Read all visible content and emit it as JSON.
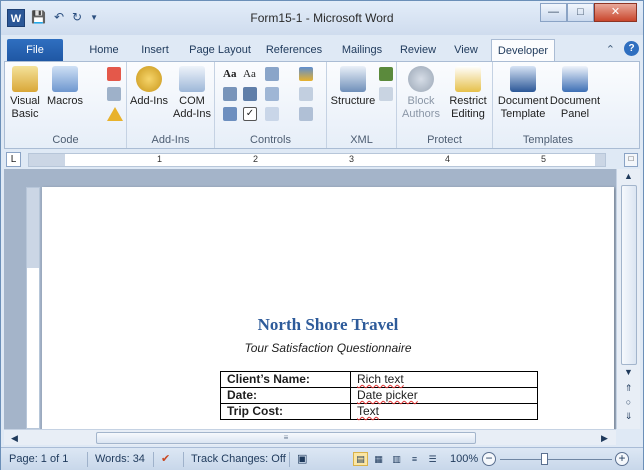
{
  "window": {
    "title": "Form15-1 - Microsoft Word",
    "app_icon": "W"
  },
  "qat": {
    "save_icon": "save-icon",
    "undo_icon": "undo-icon",
    "redo_icon": "redo-icon"
  },
  "tabs": [
    {
      "label": "File"
    },
    {
      "label": "Home"
    },
    {
      "label": "Insert"
    },
    {
      "label": "Page Layout"
    },
    {
      "label": "References"
    },
    {
      "label": "Mailings"
    },
    {
      "label": "Review"
    },
    {
      "label": "View"
    },
    {
      "label": "Developer"
    }
  ],
  "ribbon": {
    "code": {
      "label": "Code",
      "visual_basic_1": "Visual",
      "visual_basic_2": "Basic",
      "macros": "Macros"
    },
    "addins": {
      "label": "Add-Ins",
      "addins": "Add-Ins",
      "com_1": "COM",
      "com_2": "Add-Ins"
    },
    "controls": {
      "label": "Controls",
      "aa_rich": "Aa",
      "aa_plain": "Aa"
    },
    "xml": {
      "label": "XML",
      "structure": "Structure"
    },
    "protect": {
      "label": "Protect",
      "block_1": "Block",
      "block_2": "Authors",
      "restrict_1": "Restrict",
      "restrict_2": "Editing"
    },
    "templates": {
      "label": "Templates",
      "doc_template_1": "Document",
      "doc_template_2": "Template",
      "doc_panel_1": "Document",
      "doc_panel_2": "Panel"
    }
  },
  "ruler": {
    "numbers": [
      "1",
      "2",
      "3",
      "4",
      "5"
    ],
    "tab_selector": "L"
  },
  "document": {
    "title": "North Shore Travel",
    "subtitle": "Tour Satisfaction Questionnaire",
    "rows": [
      {
        "label": "Client’s Name:",
        "value": "Rich text"
      },
      {
        "label": "Date:",
        "value": "Date picker"
      },
      {
        "label": "Trip Cost:",
        "value": "Text"
      }
    ]
  },
  "statusbar": {
    "page": "Page: 1 of 1",
    "words": "Words: 34",
    "track_changes": "Track Changes: Off",
    "zoom": "100%",
    "zoom_minus": "−",
    "zoom_plus": "+"
  },
  "colors": {
    "title_blue": "#2e5b9a",
    "file_tab": "#1f57a4"
  }
}
